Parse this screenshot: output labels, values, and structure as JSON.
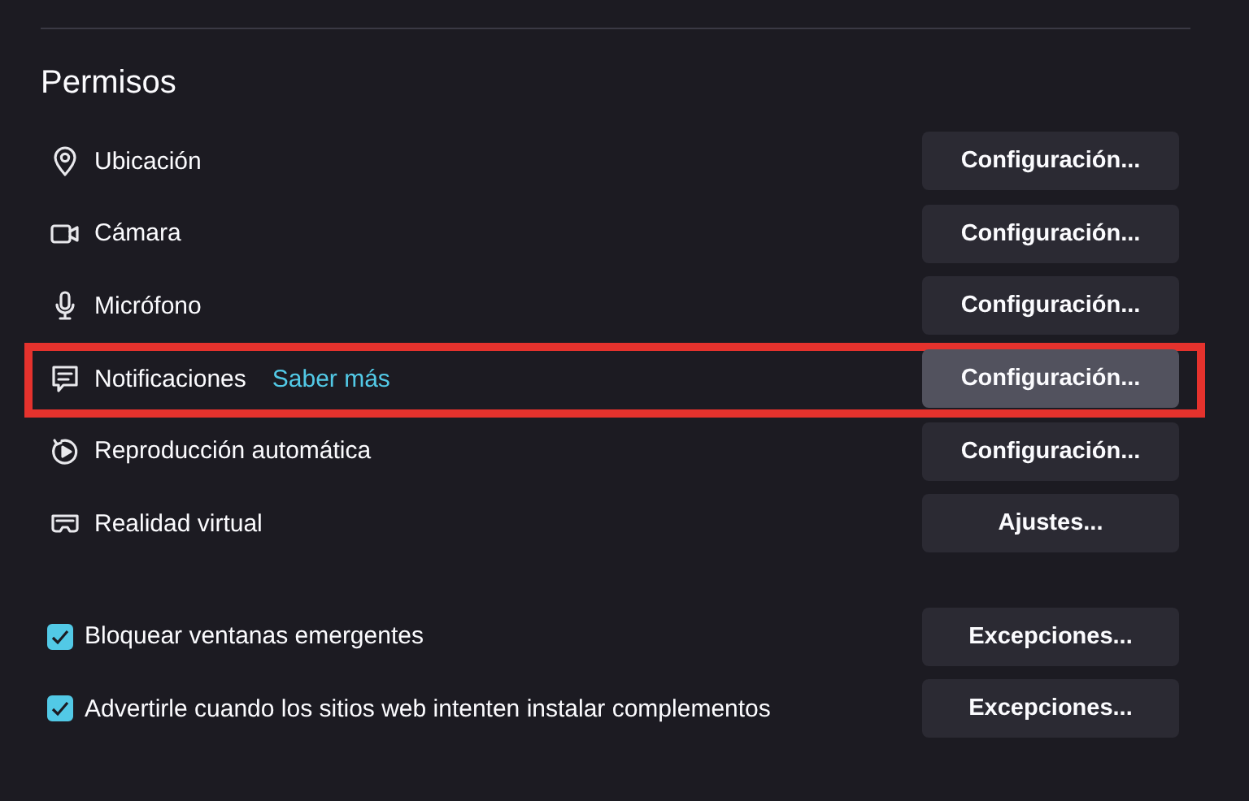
{
  "heading": "Permisos",
  "permissions": [
    {
      "label": "Ubicación",
      "button": "Configuración...",
      "highlighted": false
    },
    {
      "label": "Cámara",
      "button": "Configuración...",
      "highlighted": false
    },
    {
      "label": "Micrófono",
      "button": "Configuración...",
      "highlighted": false
    },
    {
      "label": "Notificaciones",
      "link": "Saber más",
      "button": "Configuración...",
      "highlighted": true
    },
    {
      "label": "Reproducción automática",
      "button": "Configuración...",
      "highlighted": false
    },
    {
      "label": "Realidad virtual",
      "button": "Ajustes...",
      "highlighted": false
    }
  ],
  "options": [
    {
      "label": "Bloquear ventanas emergentes",
      "checked": true,
      "button": "Excepciones..."
    },
    {
      "label": "Advertirle cuando los sitios web intenten instalar complementos",
      "checked": true,
      "button": "Excepciones..."
    }
  ]
}
